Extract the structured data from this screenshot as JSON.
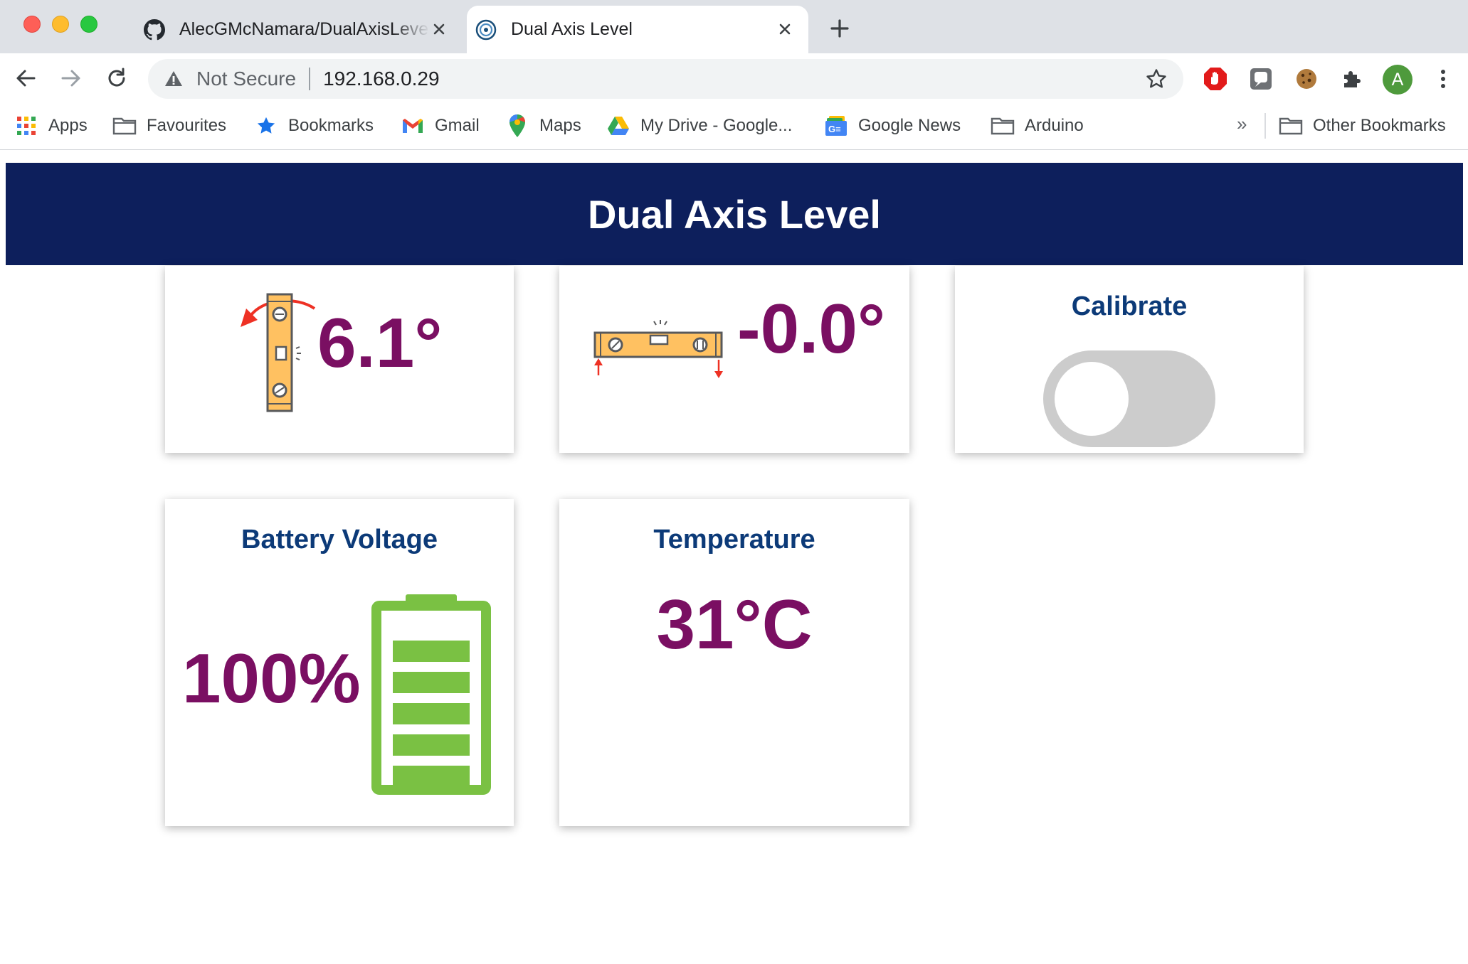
{
  "browser": {
    "tabs": [
      {
        "title": "AlecGMcNamara/DualAxisLevel",
        "icon": "github-icon"
      },
      {
        "title": "Dual Axis Level",
        "icon": "globe-icon",
        "active": true
      }
    ],
    "omnibox": {
      "security": "Not Secure",
      "url": "192.168.0.29"
    },
    "avatar_letter": "A",
    "bookmarks": [
      {
        "label": "Apps",
        "icon": "apps-grid-icon"
      },
      {
        "label": "Favourites",
        "icon": "folder-icon"
      },
      {
        "label": "Bookmarks",
        "icon": "star-icon"
      },
      {
        "label": "Gmail",
        "icon": "gmail-icon"
      },
      {
        "label": "Maps",
        "icon": "maps-pin-icon"
      },
      {
        "label": "My Drive - Google...",
        "icon": "drive-icon"
      },
      {
        "label": "Google News",
        "icon": "news-icon"
      },
      {
        "label": "Arduino",
        "icon": "folder-icon"
      }
    ],
    "overflow_label": "»",
    "other_bookmarks": "Other Bookmarks"
  },
  "page": {
    "title": "Dual Axis Level",
    "pitch": {
      "value": "6.1°",
      "icon": "vertical-level-icon"
    },
    "roll": {
      "value": "-0.0°",
      "icon": "horizontal-level-icon"
    },
    "calibrate": {
      "title": "Calibrate",
      "on": false
    },
    "battery": {
      "title": "Battery Voltage",
      "value": "100%",
      "level": 1.0,
      "icon": "battery-icon"
    },
    "temperature": {
      "title": "Temperature",
      "value": "31°C"
    }
  },
  "colors": {
    "header": "#0d1f5c",
    "value": "#7a0f62",
    "card_title": "#0c3a78",
    "battery": "#7ac143",
    "level_body": "#ffc161"
  }
}
